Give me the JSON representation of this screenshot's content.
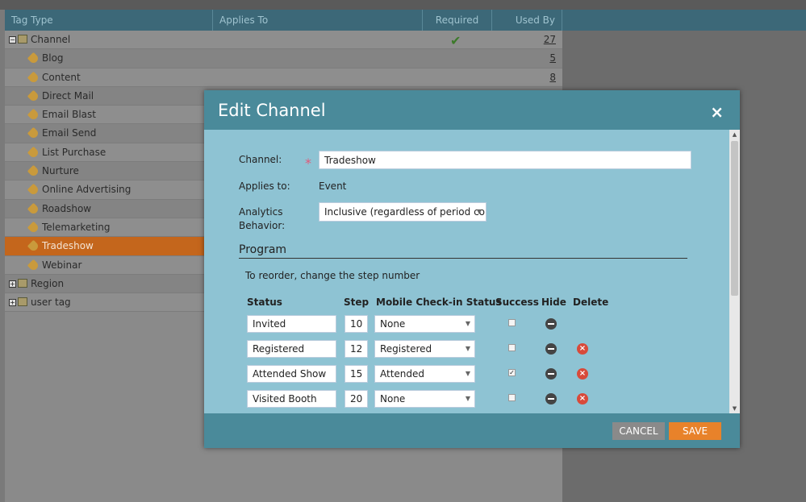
{
  "grid": {
    "columns": {
      "tag_type": "Tag Type",
      "applies_to": "Applies To",
      "required": "Required",
      "used_by": "Used By"
    },
    "rows": [
      {
        "label": "Channel",
        "level": 0,
        "toggle": "−",
        "required": "✔",
        "used_by": "27"
      },
      {
        "label": "Blog",
        "level": 1,
        "used_by": "5"
      },
      {
        "label": "Content",
        "level": 1,
        "used_by": "8"
      },
      {
        "label": "Direct Mail",
        "level": 1,
        "used_by": ""
      },
      {
        "label": "Email Blast",
        "level": 1,
        "used_by": ""
      },
      {
        "label": "Email Send",
        "level": 1,
        "used_by": ""
      },
      {
        "label": "List Purchase",
        "level": 1,
        "used_by": ""
      },
      {
        "label": "Nurture",
        "level": 1,
        "used_by": ""
      },
      {
        "label": "Online Advertising",
        "level": 1,
        "used_by": ""
      },
      {
        "label": "Roadshow",
        "level": 1,
        "used_by": ""
      },
      {
        "label": "Telemarketing",
        "level": 1,
        "used_by": ""
      },
      {
        "label": "Tradeshow",
        "level": 1,
        "used_by": "",
        "selected": true
      },
      {
        "label": "Webinar",
        "level": 1,
        "used_by": ""
      },
      {
        "label": "Region",
        "level": 0,
        "toggle": "+",
        "used_by": ""
      },
      {
        "label": "user tag",
        "level": 0,
        "toggle": "+",
        "used_by": ""
      }
    ]
  },
  "modal": {
    "title": "Edit Channel",
    "close_icon": "×",
    "channel_label": "Channel:",
    "required_star": "*",
    "channel_value": "Tradeshow",
    "applies_label": "Applies to:",
    "applies_value": "Event",
    "analytics_label_1": "Analytics",
    "analytics_label_2": "Behavior:",
    "analytics_value": "Inclusive (regardless of period co",
    "program_title": "Program",
    "reorder_hint": "To reorder, change the step number",
    "headers": {
      "status": "Status",
      "step": "Step",
      "mobile": "Mobile Check-in Status",
      "success": "Success",
      "hide": "Hide",
      "delete": "Delete"
    },
    "statuses": [
      {
        "status": "Invited",
        "step": "10",
        "mobile": "None",
        "success": false,
        "deletable": false
      },
      {
        "status": "Registered",
        "step": "12",
        "mobile": "Registered",
        "success": false,
        "deletable": true
      },
      {
        "status": "Attended Show",
        "step": "15",
        "mobile": "Attended",
        "success": true,
        "deletable": true
      },
      {
        "status": "Visited Booth",
        "step": "20",
        "mobile": "None",
        "success": false,
        "deletable": true
      }
    ],
    "cancel_label": "CANCEL",
    "save_label": "SAVE"
  },
  "colors": {
    "header_bg": "#3c6878",
    "modal_bar": "#4a8a9a",
    "modal_body": "#8ec3d3",
    "selected_row": "#c4661c",
    "save_button": "#e8822a",
    "cancel_button": "#8a8a8a",
    "delete_icon": "#d84a3a",
    "check_green": "#3c7a2a"
  }
}
